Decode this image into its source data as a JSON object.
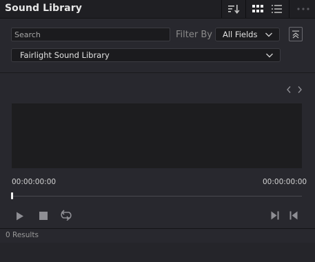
{
  "panel": {
    "title": "Sound Library"
  },
  "header_icons": {
    "sort": "sort-icon",
    "grid": "grid-view-icon",
    "list": "list-view-icon",
    "more": "more-options-icon"
  },
  "search": {
    "placeholder": "Search",
    "value": ""
  },
  "filter": {
    "label": "Filter By",
    "selected": "All Fields"
  },
  "library": {
    "selected": "Fairlight Sound Library"
  },
  "player": {
    "timecode_start": "00:00:00:00",
    "timecode_end": "00:00:00:00",
    "progress": 0
  },
  "footer": {
    "results": "0 Results"
  },
  "colors": {
    "panel_bg": "#28282e",
    "header_bg": "#1f1f23",
    "waveform_bg": "#1d1d1f",
    "accent_text": "#e6e6e6"
  }
}
